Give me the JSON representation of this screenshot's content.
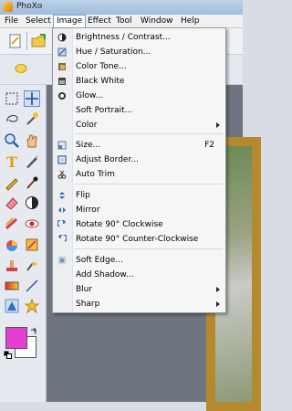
{
  "app": {
    "title": "PhoXo"
  },
  "menubar": {
    "items": [
      {
        "label": "File"
      },
      {
        "label": "Select"
      },
      {
        "label": "Image"
      },
      {
        "label": "Effect"
      },
      {
        "label": "Tool"
      },
      {
        "label": "Window"
      },
      {
        "label": "Help"
      }
    ]
  },
  "image_menu": {
    "items": [
      {
        "label": "Brightness / Contrast...",
        "icon": "brightness-contrast-icon"
      },
      {
        "label": "Hue / Saturation...",
        "icon": "hue-saturation-icon"
      },
      {
        "label": "Color Tone...",
        "icon": "color-tone-icon"
      },
      {
        "label": "Black White",
        "icon": "black-white-icon"
      },
      {
        "label": "Glow...",
        "icon": "glow-icon"
      },
      {
        "label": "Soft Portrait...",
        "icon": ""
      },
      {
        "label": "Color",
        "icon": "",
        "submenu": true
      },
      {
        "label": "Size...",
        "icon": "size-icon",
        "shortcut": "F2"
      },
      {
        "label": "Adjust Border...",
        "icon": "adjust-border-icon"
      },
      {
        "label": "Auto Trim",
        "icon": "auto-trim-icon"
      },
      {
        "label": "Flip",
        "icon": "flip-icon"
      },
      {
        "label": "Mirror",
        "icon": "mirror-icon"
      },
      {
        "label": "Rotate 90° Clockwise",
        "icon": "rotate-cw-icon"
      },
      {
        "label": "Rotate 90° Counter-Clockwise",
        "icon": "rotate-ccw-icon"
      },
      {
        "label": "Soft Edge...",
        "icon": "soft-edge-icon"
      },
      {
        "label": "Add Shadow...",
        "icon": ""
      },
      {
        "label": "Blur",
        "icon": "",
        "submenu": true
      },
      {
        "label": "Sharp",
        "icon": "",
        "submenu": true
      }
    ]
  },
  "colors": {
    "foreground": "#e53ed1",
    "background": "#ffffff",
    "menu_highlight_border": "#7a9ccc"
  }
}
